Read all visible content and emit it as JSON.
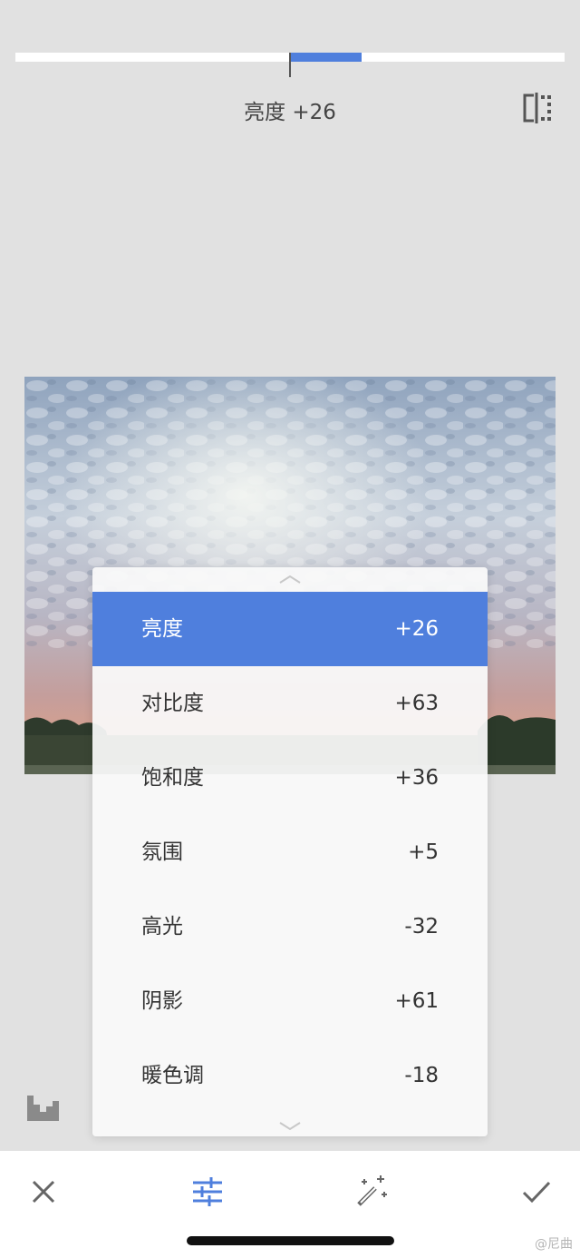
{
  "slider": {
    "value": 26,
    "min": -100,
    "max": 100
  },
  "header": {
    "label": "亮度 +26"
  },
  "icons": {
    "compare": "compare-icon",
    "histogram": "histogram-icon",
    "cancel": "close-icon",
    "tune": "sliders-icon",
    "auto": "magic-wand-icon",
    "apply": "check-icon",
    "menu_up": "chevron-up-icon",
    "menu_down": "chevron-down-icon"
  },
  "menu": {
    "items": [
      {
        "label": "亮度",
        "value": "+26",
        "selected": true
      },
      {
        "label": "对比度",
        "value": "+63",
        "selected": false
      },
      {
        "label": "饱和度",
        "value": "+36",
        "selected": false
      },
      {
        "label": "氛围",
        "value": "+5",
        "selected": false
      },
      {
        "label": "高光",
        "value": "-32",
        "selected": false
      },
      {
        "label": "阴影",
        "value": "+61",
        "selected": false
      },
      {
        "label": "暖色调",
        "value": "-18",
        "selected": false
      }
    ]
  },
  "watermark": "@尼曲",
  "colors": {
    "accent": "#4f7fdd",
    "background": "#e1e1e1"
  }
}
